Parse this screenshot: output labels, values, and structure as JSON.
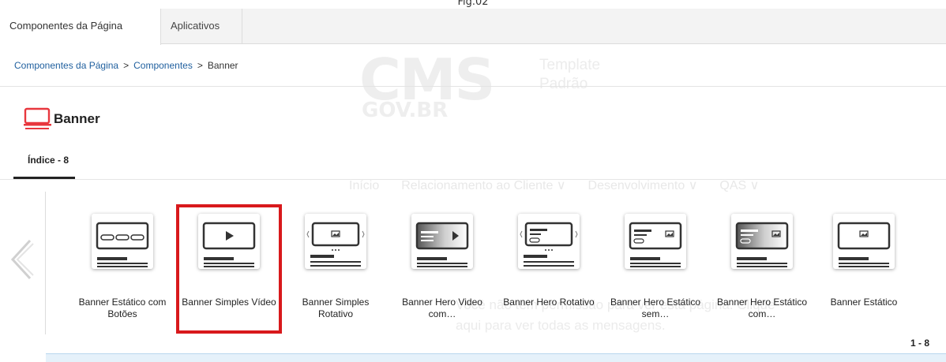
{
  "caption": "Fig.02",
  "tabs": [
    {
      "label": "Componentes da Página"
    },
    {
      "label": "Aplicativos"
    }
  ],
  "background": {
    "logo_main": "CMS",
    "logo_sub": "GOV.BR",
    "template_line1": "Template",
    "template_line2": "Padrão",
    "menu": [
      "Início",
      "Relacionamento ao Cliente ∨",
      "Desenvolvimento ∨",
      "QAS ∨"
    ],
    "message_line1": "Você não tem permissão para ver esta página. Clique",
    "message_line2": "aqui para ver todas as mensagens."
  },
  "breadcrumb": {
    "items": [
      "Componentes da Página",
      "Componentes",
      "Banner"
    ],
    "separator": ">"
  },
  "page": {
    "title": "Banner",
    "icon": "banner-monitor-icon",
    "index_tab": "Índice - 8"
  },
  "components": [
    {
      "label": "Banner Estático com Botões",
      "icon": "banner-buttons-icon"
    },
    {
      "label": "Banner Simples Vídeo",
      "icon": "banner-video-icon",
      "selected": true
    },
    {
      "label": "Banner Simples Rotativo",
      "icon": "banner-carousel-icon"
    },
    {
      "label": "Banner Hero Video com…",
      "icon": "banner-hero-video-icon"
    },
    {
      "label": "Banner Hero Rotativo",
      "icon": "banner-hero-carousel-icon"
    },
    {
      "label": "Banner Hero Estático sem…",
      "icon": "banner-hero-static-icon"
    },
    {
      "label": "Banner Hero Estático com…",
      "icon": "banner-hero-static-gradient-icon"
    },
    {
      "label": "Banner Estático",
      "icon": "banner-static-icon"
    }
  ],
  "pagination": "1 - 8",
  "colors": {
    "accent_red": "#d8191c",
    "link_blue": "#1f5f9e",
    "icon_red": "#e8373e"
  }
}
